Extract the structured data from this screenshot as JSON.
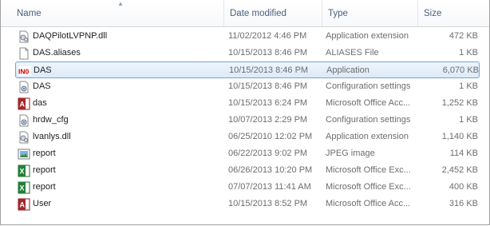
{
  "columns": {
    "name": "Name",
    "date_modified": "Date modified",
    "type": "Type",
    "size": "Size"
  },
  "files": [
    {
      "name": "DAQPilotLVPNP.dll",
      "date": "11/02/2012 4:46 PM",
      "type": "Application extension",
      "size": "472 KB",
      "icon": "dll-icon"
    },
    {
      "name": "DAS.aliases",
      "date": "10/15/2013 8:46 PM",
      "type": "ALIASES File",
      "size": "1 KB",
      "icon": "blank-file-icon"
    },
    {
      "name": "DAS",
      "date": "10/15/2013 8:46 PM",
      "type": "Application",
      "size": "6,070 KB",
      "icon": "labview-app-icon",
      "selected": true
    },
    {
      "name": "DAS",
      "date": "10/15/2013 8:46 PM",
      "type": "Configuration settings",
      "size": "1 KB",
      "icon": "config-icon"
    },
    {
      "name": "das",
      "date": "10/15/2013 6:24 PM",
      "type": "Microsoft Office Acc...",
      "size": "1,252 KB",
      "icon": "access-icon"
    },
    {
      "name": "hrdw_cfg",
      "date": "10/07/2013 2:29 PM",
      "type": "Configuration settings",
      "size": "1 KB",
      "icon": "config-icon"
    },
    {
      "name": "lvanlys.dll",
      "date": "06/25/2010 12:02 PM",
      "type": "Application extension",
      "size": "1,140 KB",
      "icon": "dll-icon"
    },
    {
      "name": "report",
      "date": "06/22/2013 9:02 PM",
      "type": "JPEG image",
      "size": "114 KB",
      "icon": "jpeg-icon"
    },
    {
      "name": "report",
      "date": "06/26/2013 10:20 PM",
      "type": "Microsoft Office Exc...",
      "size": "2,452 KB",
      "icon": "excel-icon"
    },
    {
      "name": "report",
      "date": "07/07/2013 11:41 AM",
      "type": "Microsoft Office Exc...",
      "size": "400 KB",
      "icon": "excel-icon"
    },
    {
      "name": "User",
      "date": "10/15/2013 8:52 PM",
      "type": "Microsoft Office Acc...",
      "size": "316 KB",
      "icon": "access-icon"
    }
  ],
  "icon_text": {
    "labview": "IN0",
    "access": "A",
    "excel": "X"
  },
  "colors": {
    "header_text": "#4c607a",
    "secondary_text": "#6d6d6d",
    "selection_border": "#7da2ce",
    "selection_fill": "#dbeaf9"
  }
}
